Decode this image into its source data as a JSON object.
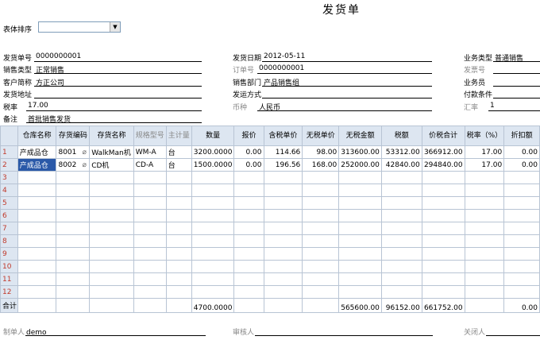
{
  "title": "发货单",
  "sort": {
    "label": "表体排序",
    "value": ""
  },
  "header_fields": [
    {
      "id": "ship_no",
      "label": "发货单号",
      "value": "0000000001",
      "gray": false
    },
    {
      "id": "ship_date",
      "label": "发货日期",
      "value": "2012-05-11",
      "gray": false
    },
    {
      "id": "biz_type",
      "label": "业务类型",
      "value": "普通销售",
      "gray": false
    },
    {
      "id": "sales_type",
      "label": "销售类型",
      "value": "正常销售",
      "gray": false
    },
    {
      "id": "order_no",
      "label": "订单号",
      "value": "0000000001",
      "gray": true
    },
    {
      "id": "invoice_no",
      "label": "发票号",
      "value": "",
      "gray": true
    },
    {
      "id": "customer",
      "label": "客户简称",
      "value": "方正公司",
      "gray": false
    },
    {
      "id": "sales_dept",
      "label": "销售部门",
      "value": "产品销售组",
      "gray": false
    },
    {
      "id": "salesman",
      "label": "业务员",
      "value": "",
      "gray": false
    },
    {
      "id": "ship_addr",
      "label": "发货地址",
      "value": "",
      "gray": false
    },
    {
      "id": "ship_method",
      "label": "发运方式",
      "value": "",
      "gray": false
    },
    {
      "id": "pay_terms",
      "label": "付款条件",
      "value": "",
      "gray": false
    },
    {
      "id": "tax_rate",
      "label": "税率",
      "value": "17.00",
      "gray": false
    },
    {
      "id": "currency",
      "label": "币种",
      "value": "人民币",
      "gray": true
    },
    {
      "id": "exch_rate",
      "label": "汇率",
      "value": "1",
      "gray": true
    },
    {
      "id": "remark",
      "label": "备注",
      "value": "首批销售发货",
      "gray": false
    }
  ],
  "table": {
    "columns": [
      {
        "label": "仓库名称",
        "gray": false
      },
      {
        "label": "存货编码",
        "gray": false
      },
      {
        "label": "存货名称",
        "gray": false
      },
      {
        "label": "规格型号",
        "gray": true
      },
      {
        "label": "主计量",
        "gray": true
      },
      {
        "label": "数量",
        "gray": false
      },
      {
        "label": "报价",
        "gray": false
      },
      {
        "label": "含税单价",
        "gray": false
      },
      {
        "label": "无税单价",
        "gray": false
      },
      {
        "label": "无税金额",
        "gray": false
      },
      {
        "label": "税额",
        "gray": false
      },
      {
        "label": "价税合计",
        "gray": false
      },
      {
        "label": "税率（%）",
        "gray": false
      },
      {
        "label": "折扣额",
        "gray": false
      }
    ],
    "rows": [
      {
        "no": "1",
        "cells": [
          "产成品仓",
          "8001",
          "WalkMan机",
          "WM-A",
          "台",
          "3200.0000",
          "0.00",
          "114.66",
          "98.00",
          "313600.00",
          "53312.00",
          "366912.00",
          "17.00",
          "0.00"
        ]
      },
      {
        "no": "2",
        "cells": [
          "产成品仓",
          "8002",
          "CD机",
          "CD-A",
          "台",
          "1500.0000",
          "0.00",
          "196.56",
          "168.00",
          "252000.00",
          "42840.00",
          "294840.00",
          "17.00",
          "0.00"
        ]
      },
      {
        "no": "3",
        "cells": [
          "",
          "",
          "",
          "",
          "",
          "",
          "",
          "",
          "",
          "",
          "",
          "",
          "",
          ""
        ]
      },
      {
        "no": "4",
        "cells": [
          "",
          "",
          "",
          "",
          "",
          "",
          "",
          "",
          "",
          "",
          "",
          "",
          "",
          ""
        ]
      },
      {
        "no": "5",
        "cells": [
          "",
          "",
          "",
          "",
          "",
          "",
          "",
          "",
          "",
          "",
          "",
          "",
          "",
          ""
        ]
      },
      {
        "no": "6",
        "cells": [
          "",
          "",
          "",
          "",
          "",
          "",
          "",
          "",
          "",
          "",
          "",
          "",
          "",
          ""
        ]
      },
      {
        "no": "7",
        "cells": [
          "",
          "",
          "",
          "",
          "",
          "",
          "",
          "",
          "",
          "",
          "",
          "",
          "",
          ""
        ]
      },
      {
        "no": "8",
        "cells": [
          "",
          "",
          "",
          "",
          "",
          "",
          "",
          "",
          "",
          "",
          "",
          "",
          "",
          ""
        ]
      },
      {
        "no": "9",
        "cells": [
          "",
          "",
          "",
          "",
          "",
          "",
          "",
          "",
          "",
          "",
          "",
          "",
          "",
          ""
        ]
      },
      {
        "no": "10",
        "cells": [
          "",
          "",
          "",
          "",
          "",
          "",
          "",
          "",
          "",
          "",
          "",
          "",
          "",
          ""
        ]
      },
      {
        "no": "11",
        "cells": [
          "",
          "",
          "",
          "",
          "",
          "",
          "",
          "",
          "",
          "",
          "",
          "",
          "",
          ""
        ]
      },
      {
        "no": "12",
        "cells": [
          "",
          "",
          "",
          "",
          "",
          "",
          "",
          "",
          "",
          "",
          "",
          "",
          "",
          ""
        ]
      }
    ],
    "total": {
      "label": "合计",
      "cells": [
        "",
        "",
        "",
        "",
        "",
        "4700.0000",
        "",
        "",
        "",
        "565600.00",
        "96152.00",
        "661752.00",
        "",
        "0.00"
      ]
    }
  },
  "footer": [
    {
      "id": "maker",
      "label": "制单人",
      "value": "demo"
    },
    {
      "id": "auditor",
      "label": "审核人",
      "value": ""
    },
    {
      "id": "closer",
      "label": "关闭人",
      "value": ""
    }
  ]
}
